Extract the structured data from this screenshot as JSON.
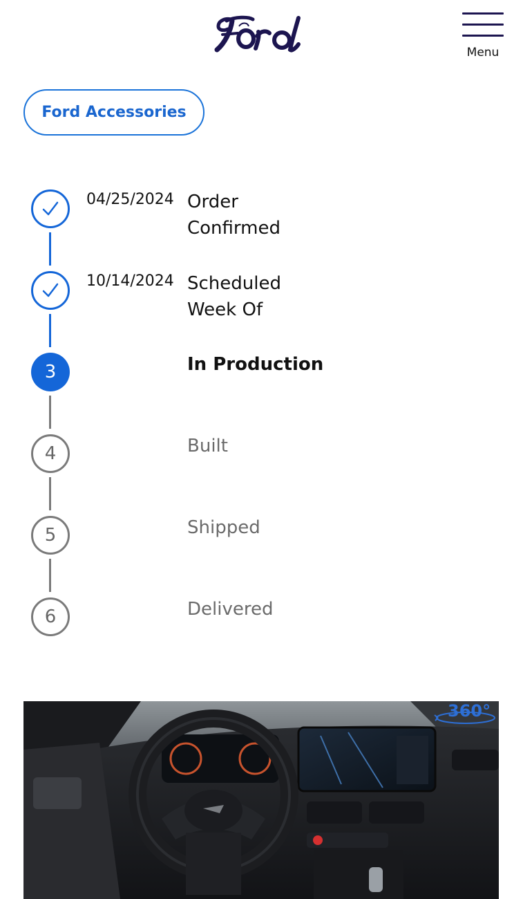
{
  "header": {
    "logo_text": "Ford",
    "menu_label": "Menu"
  },
  "accessories_button": {
    "label": "Ford Accessories"
  },
  "timeline": {
    "steps": [
      {
        "number": "1",
        "status": "complete",
        "date": "04/25/2024",
        "label_line1": "Order",
        "label_line2": "Confirmed"
      },
      {
        "number": "2",
        "status": "complete",
        "date": "10/14/2024",
        "label_line1": "Scheduled",
        "label_line2": "Week Of"
      },
      {
        "number": "3",
        "status": "current",
        "label": "In Production"
      },
      {
        "number": "4",
        "status": "pending",
        "label": "Built"
      },
      {
        "number": "5",
        "status": "pending",
        "label": "Shipped"
      },
      {
        "number": "6",
        "status": "pending",
        "label": "Delivered"
      }
    ]
  },
  "vehicle_view": {
    "badge_text": "360°"
  },
  "colors": {
    "brand_navy": "#1c1550",
    "accent_blue": "#1466d8",
    "pending_gray": "#7a7a7a"
  },
  "icons": {
    "complete": "checkmark-icon",
    "menu": "hamburger-icon",
    "rotate": "360-rotate-icon"
  }
}
